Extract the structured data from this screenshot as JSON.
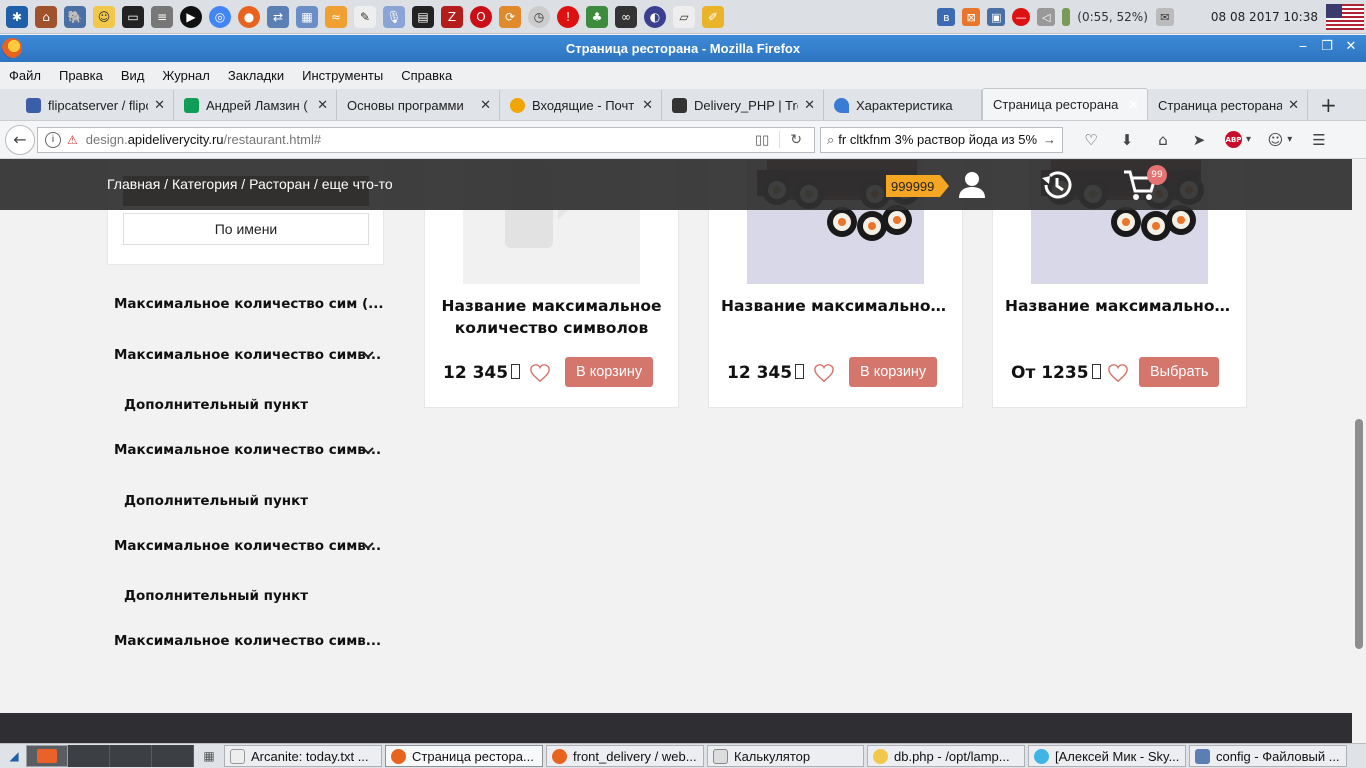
{
  "system_panel": {
    "launcher_icons": [
      "kde-menu-icon",
      "house-app-icon",
      "database-icon",
      "smiley-app-icon",
      "terminal-icon",
      "disk-icon",
      "media-player-icon",
      "chrome-icon",
      "firefox-icon",
      "network-app-icon",
      "chart-app-icon",
      "wifi-icon",
      "text-editor-icon",
      "microphone-icon",
      "system-monitor-icon",
      "filezilla-icon",
      "opera-icon",
      "torrent-icon",
      "clock-app-icon",
      "alert-app-icon",
      "tree-app-icon",
      "binoculars-icon",
      "eclipse-icon",
      "notes-icon",
      "paint-icon"
    ],
    "battery": "(0:55, 52%)",
    "clock": "08 08 2017 10:38"
  },
  "window": {
    "title": "Страница ресторана - Mozilla Firefox"
  },
  "menubar": [
    "Файл",
    "Правка",
    "Вид",
    "Журнал",
    "Закладки",
    "Инструменты",
    "Справка"
  ],
  "tabs": [
    {
      "label": "flipcatserver / flipc",
      "color": "#3b5ea8"
    },
    {
      "label": "Андрей Ламзин (",
      "color": "#0f9d58"
    },
    {
      "label": "Основы программи",
      "color": "#999999"
    },
    {
      "label": "Входящие - Почт",
      "color": "#f0a500"
    },
    {
      "label": "Delivery_PHP | Tre",
      "color": "#333333"
    },
    {
      "label": "Характеристика",
      "color": "#3a7bd5"
    },
    {
      "label": "Страница ресторана",
      "color": "#ffffff"
    },
    {
      "label": "Страница ресторана",
      "color": "#ffffff"
    }
  ],
  "url": {
    "prefix": "design.",
    "domain": "apideliverycity.ru",
    "path": "/restaurant.html#"
  },
  "search": {
    "value": "fr cltkfnm 3% раствор йода из 5%"
  },
  "site": {
    "breadcrumb": "Главная / Категория / Расторан / еще что-то",
    "balance": "999999",
    "cart_count": "99",
    "sort_by_name": "По имени"
  },
  "categories": {
    "c1": "Максимальное количество сим (...",
    "c2": "Максимальное количество симв...",
    "s1": "Дополнительный пункт",
    "c3": "Максимальное количество симв...",
    "s2": "Дополнительный пункт",
    "c4": "Максимальное количество симв...",
    "s3": "Дополнительный пункт",
    "c5": "Максимальное количество симв..."
  },
  "products": [
    {
      "name": "Название максимальное количество символов",
      "price": "12 345",
      "button": "В корзину"
    },
    {
      "name": "Название максимальное ...",
      "price": "12 345",
      "button": "В корзину"
    },
    {
      "name": "Название максимальное ...",
      "price": "От 1235",
      "button": "Выбрать"
    }
  ],
  "taskbar": {
    "items": [
      "Arcanite: today.txt ...",
      "Страница рестора...",
      "front_delivery / web...",
      "Калькулятор",
      "db.php - /opt/lamp...",
      "[Алексей Мик - Sky...",
      "config - Файловый ..."
    ]
  },
  "colors": {
    "accent_button": "#d4766c",
    "balance_badge": "#f5a623",
    "header_bg": "#303030"
  }
}
